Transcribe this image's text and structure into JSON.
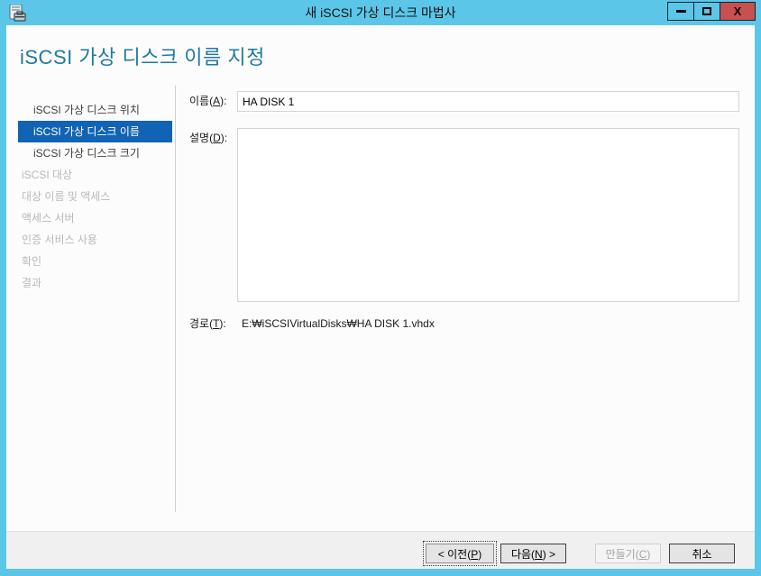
{
  "colors": {
    "frame_blue": "#5BC6E8",
    "close_button_red": "#C75050",
    "heading_teal": "#1F7A9C",
    "selected_nav_blue": "#1164B4"
  },
  "window": {
    "title": "새 iSCSI 가상 디스크 마법사",
    "close_glyph": "X",
    "icons": {
      "app": "server-manager-icon",
      "minimize": "minus-bar",
      "maximize": "square-outline",
      "close": "x-glyph"
    }
  },
  "page": {
    "heading": "iSCSI 가상 디스크 이름 지정"
  },
  "sidebar": {
    "items": [
      {
        "label": "iSCSI 가상 디스크 위치",
        "state": "enabled"
      },
      {
        "label": "iSCSI 가상 디스크 이름",
        "state": "selected"
      },
      {
        "label": "iSCSI 가상 디스크 크기",
        "state": "enabled"
      },
      {
        "label": "iSCSI 대상",
        "state": "disabled"
      },
      {
        "label": "대상 이름 및 액세스",
        "state": "disabled"
      },
      {
        "label": "액세스 서버",
        "state": "disabled"
      },
      {
        "label": "인증 서비스 사용",
        "state": "disabled"
      },
      {
        "label": "확인",
        "state": "disabled"
      },
      {
        "label": "결과",
        "state": "disabled"
      }
    ]
  },
  "form": {
    "name_label": {
      "pre": "이름(",
      "key": "A",
      "post": "):"
    },
    "name_value": "HA DISK 1",
    "desc_label": {
      "pre": "설명(",
      "key": "D",
      "post": "):"
    },
    "desc_value": "",
    "path_label": {
      "pre": "경로(",
      "key": "T",
      "post": "):"
    },
    "path_value": "E:₩iSCSIVirtualDisks₩HA DISK 1.vhdx"
  },
  "footer": {
    "prev": {
      "pre": "< 이전(",
      "key": "P",
      "post": ")"
    },
    "next": {
      "pre": "다음(",
      "key": "N",
      "post": ") >"
    },
    "create": {
      "pre": "만들기(",
      "key": "C",
      "post": ")"
    },
    "cancel_label": "취소"
  }
}
